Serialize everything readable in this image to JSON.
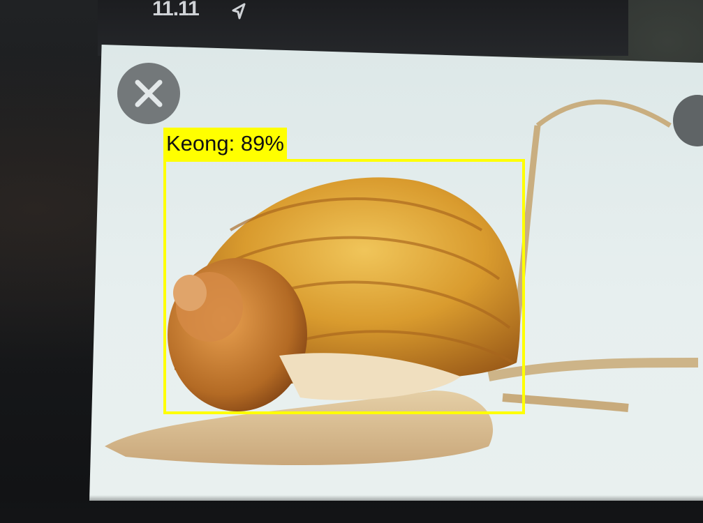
{
  "status_bar": {
    "time": "11.11",
    "location_icon": "location-arrow-icon"
  },
  "controls": {
    "close_icon": "close-icon"
  },
  "detection": {
    "label": "Keong: 89%",
    "box_color": "#ffff00"
  }
}
